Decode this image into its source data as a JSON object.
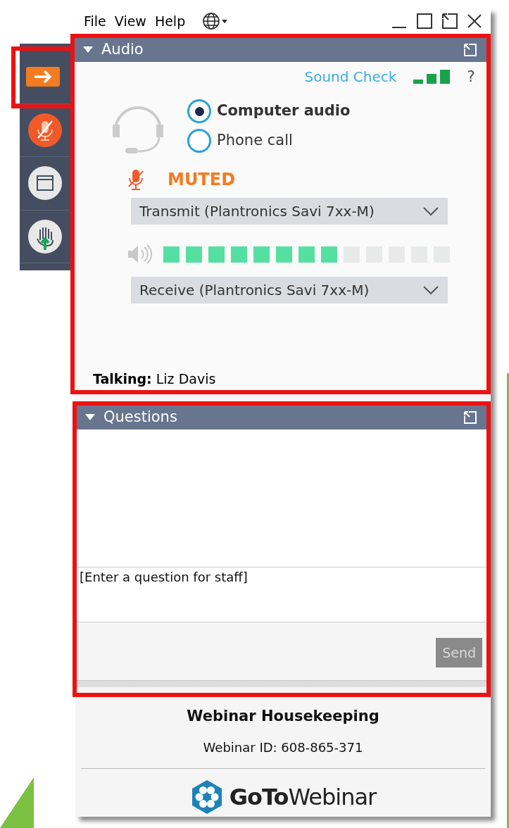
{
  "menu": [
    "File",
    "View",
    "Help"
  ],
  "sidebar": [
    {
      "kind": "arrow",
      "highlighted": true
    },
    {
      "kind": "mic-muted",
      "highlighted": false
    },
    {
      "kind": "window",
      "highlighted": false
    },
    {
      "kind": "hand",
      "highlighted": false
    }
  ],
  "audio": {
    "title": "Audio",
    "highlighted": true,
    "sound_check": "Sound Check",
    "help": "?",
    "options": [
      {
        "label": "Computer audio",
        "selected": true
      },
      {
        "label": "Phone call",
        "selected": false
      }
    ],
    "mute_status": "MUTED",
    "muted": true,
    "transmit": "Transmit (Plantronics Savi 7xx-M)",
    "speaker": {
      "level": 0.615
    },
    "receive": "Receive (Plantronics Savi 7xx-M)",
    "talking": "**Talking:** Liz Davis"
  },
  "questions": {
    "title": "Questions",
    "highlighted": true,
    "placeholder": "[Enter a question for staff]",
    "send": {
      "label": "Send",
      "disabled": true
    }
  },
  "footer": {
    "title": "Webinar Housekeeping",
    "webinar_id": "Webinar ID: 608-865-371",
    "logo": "**GoTo**Webinar"
  }
}
